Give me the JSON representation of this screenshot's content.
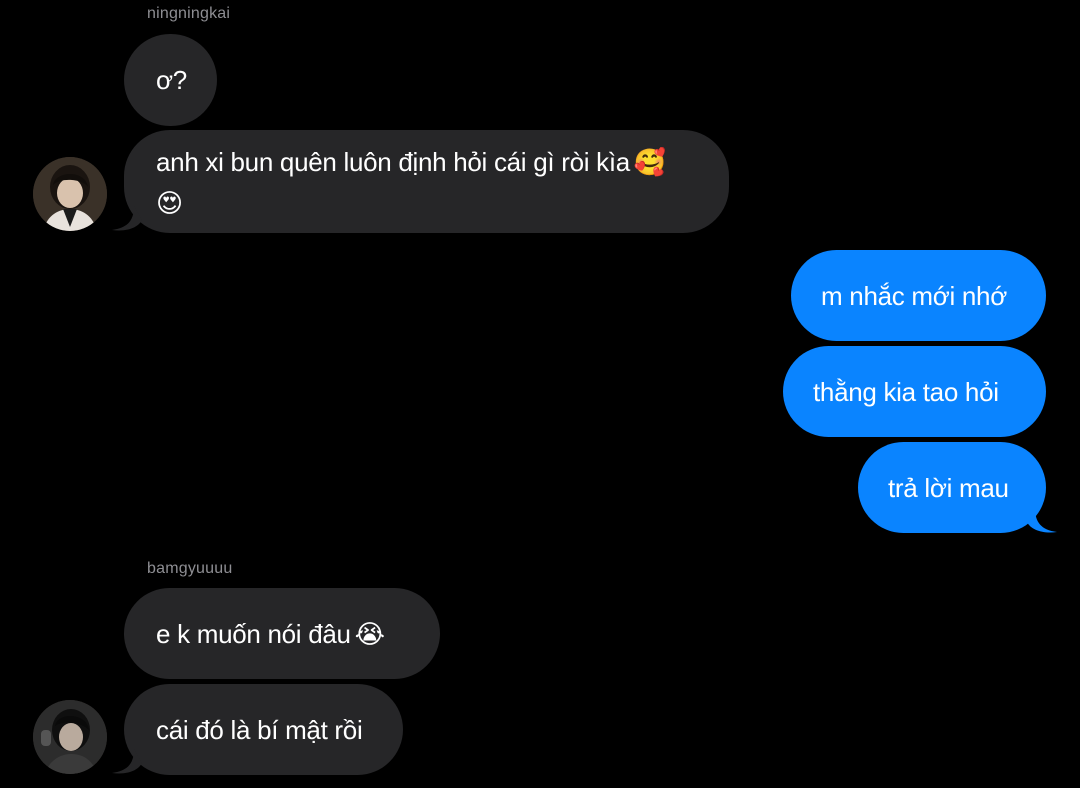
{
  "colors": {
    "background": "#000000",
    "incoming_bubble": "#262628",
    "outgoing_bubble": "#0a84ff",
    "sender_name": "#8e8e93"
  },
  "conversation": {
    "group1": {
      "sender": "ningningkai",
      "messages": [
        {
          "text": "ơ?"
        },
        {
          "text": "anh xi bun quên luôn định hỏi cái gì ròi kìa",
          "emoji_1": "🥰",
          "emoji_2": "😍",
          "emoji_names": [
            "smiling-face-with-hearts-icon",
            "heart-eyes-icon"
          ]
        }
      ],
      "avatar_icon": "profile-photo-icon"
    },
    "outgoing": {
      "messages": [
        {
          "text": "m nhắc mới nhớ"
        },
        {
          "text": "thằng kia tao hỏi"
        },
        {
          "text": "trả lời mau"
        }
      ]
    },
    "group2": {
      "sender": "bamgyuuuu",
      "messages": [
        {
          "text": "e k muốn nói đâu",
          "emoji": "😭",
          "emoji_name": "loudly-crying-face-icon"
        },
        {
          "text": "cái đó là bí mật rồi"
        }
      ],
      "avatar_icon": "profile-photo-icon"
    }
  }
}
